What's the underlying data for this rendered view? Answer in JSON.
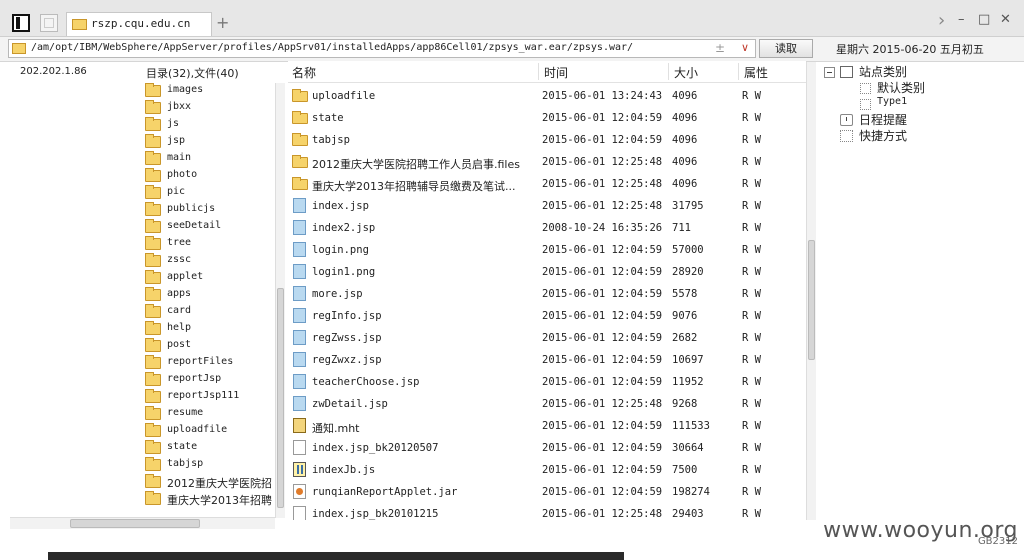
{
  "tab": {
    "title": "rszp.cqu.edu.cn",
    "close": "×",
    "new_tab": "+"
  },
  "window_controls": {
    "forward": "›",
    "minimize": "–",
    "maximize": "□",
    "close": "✕"
  },
  "address": {
    "path": "/am/opt/IBM/WebSphere/AppServer/profiles/AppSrv01/installedApps/app86Cell01/zpsys_war.ear/zpsys.war/",
    "read_label": "读取"
  },
  "date_text": "星期六 2015-06-20 五月初五",
  "ip": "202.202.1.86",
  "tree": {
    "header": "目录(32),文件(40)",
    "items": [
      "images",
      "jbxx",
      "js",
      "jsp",
      "main",
      "photo",
      "pic",
      "publicjs",
      "seeDetail",
      "tree",
      "zssc",
      "applet",
      "apps",
      "card",
      "help",
      "post",
      "reportFiles",
      "reportJsp",
      "reportJsp111",
      "resume",
      "uploadfile",
      "state",
      "tabjsp",
      "2012重庆大学医院招",
      "重庆大学2013年招聘"
    ]
  },
  "file_list": {
    "columns": {
      "name": "名称",
      "time": "时间",
      "size": "大小",
      "attr": "属性"
    },
    "rows": [
      {
        "name": "uploadfile",
        "time": "2015-06-01 13:24:43",
        "size": "4096",
        "attr": "R W",
        "icon": "folder"
      },
      {
        "name": "state",
        "time": "2015-06-01 12:04:59",
        "size": "4096",
        "attr": "R W",
        "icon": "folder"
      },
      {
        "name": "tabjsp",
        "time": "2015-06-01 12:04:59",
        "size": "4096",
        "attr": "R W",
        "icon": "folder"
      },
      {
        "name": "2012重庆大学医院招聘工作人员启事.files",
        "time": "2015-06-01 12:25:48",
        "size": "4096",
        "attr": "R W",
        "icon": "folder"
      },
      {
        "name": "重庆大学2013年招聘辅导员缴费及笔试...",
        "time": "2015-06-01 12:25:48",
        "size": "4096",
        "attr": "R W",
        "icon": "folder"
      },
      {
        "name": "index.jsp",
        "time": "2015-06-01 12:25:48",
        "size": "31795",
        "attr": "R W",
        "icon": "file"
      },
      {
        "name": "index2.jsp",
        "time": "2008-10-24 16:35:26",
        "size": "711",
        "attr": "R W",
        "icon": "file"
      },
      {
        "name": "login.png",
        "time": "2015-06-01 12:04:59",
        "size": "57000",
        "attr": "R W",
        "icon": "file"
      },
      {
        "name": "login1.png",
        "time": "2015-06-01 12:04:59",
        "size": "28920",
        "attr": "R W",
        "icon": "file"
      },
      {
        "name": "more.jsp",
        "time": "2015-06-01 12:04:59",
        "size": "5578",
        "attr": "R W",
        "icon": "file"
      },
      {
        "name": "regInfo.jsp",
        "time": "2015-06-01 12:04:59",
        "size": "9076",
        "attr": "R W",
        "icon": "file"
      },
      {
        "name": "regZwss.jsp",
        "time": "2015-06-01 12:04:59",
        "size": "2682",
        "attr": "R W",
        "icon": "file"
      },
      {
        "name": "regZwxz.jsp",
        "time": "2015-06-01 12:04:59",
        "size": "10697",
        "attr": "R W",
        "icon": "file"
      },
      {
        "name": "teacherChoose.jsp",
        "time": "2015-06-01 12:04:59",
        "size": "11952",
        "attr": "R W",
        "icon": "file"
      },
      {
        "name": "zwDetail.jsp",
        "time": "2015-06-01 12:25:48",
        "size": "9268",
        "attr": "R W",
        "icon": "file"
      },
      {
        "name": "通知.mht",
        "time": "2015-06-01 12:04:59",
        "size": "111533",
        "attr": "R W",
        "icon": "mht"
      },
      {
        "name": "index.jsp_bk20120507",
        "time": "2015-06-01 12:04:59",
        "size": "30664",
        "attr": "R W",
        "icon": "blank"
      },
      {
        "name": "indexJb.js",
        "time": "2015-06-01 12:04:59",
        "size": "7500",
        "attr": "R W",
        "icon": "js"
      },
      {
        "name": "runqianReportApplet.jar",
        "time": "2015-06-01 12:04:59",
        "size": "198274",
        "attr": "R W",
        "icon": "jar"
      },
      {
        "name": "index.jsp_bk20101215",
        "time": "2015-06-01 12:25:48",
        "size": "29403",
        "attr": "R W",
        "icon": "blank"
      }
    ]
  },
  "right_panel": {
    "site_category": "站点类别",
    "default_category": "默认类别",
    "type1": "Type1",
    "schedule": "日程提醒",
    "shortcut": "快捷方式"
  },
  "watermark": "www.wooyun.org",
  "encoding": "GB2312"
}
